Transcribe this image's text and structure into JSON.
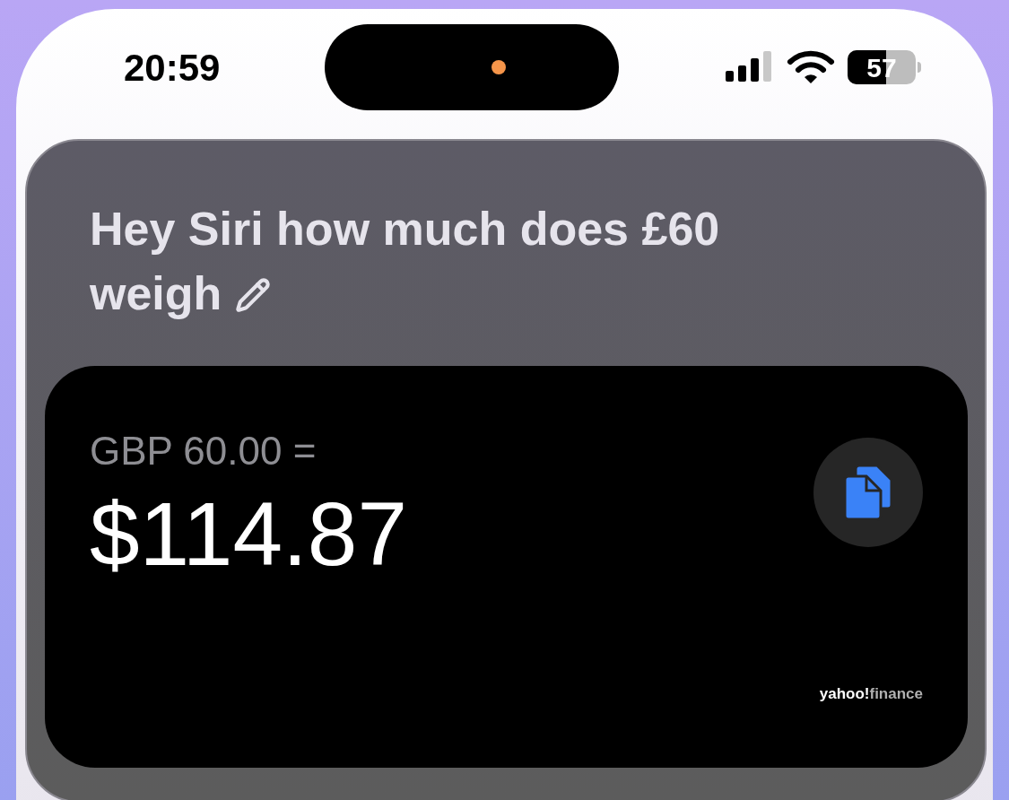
{
  "status_bar": {
    "time": "20:59",
    "battery": "57"
  },
  "siri": {
    "query": "Hey Siri how much does £60 weigh"
  },
  "result": {
    "from": "GBP 60.00 =",
    "amount": "$114.87",
    "source": [
      "yahoo!",
      "finance"
    ]
  }
}
